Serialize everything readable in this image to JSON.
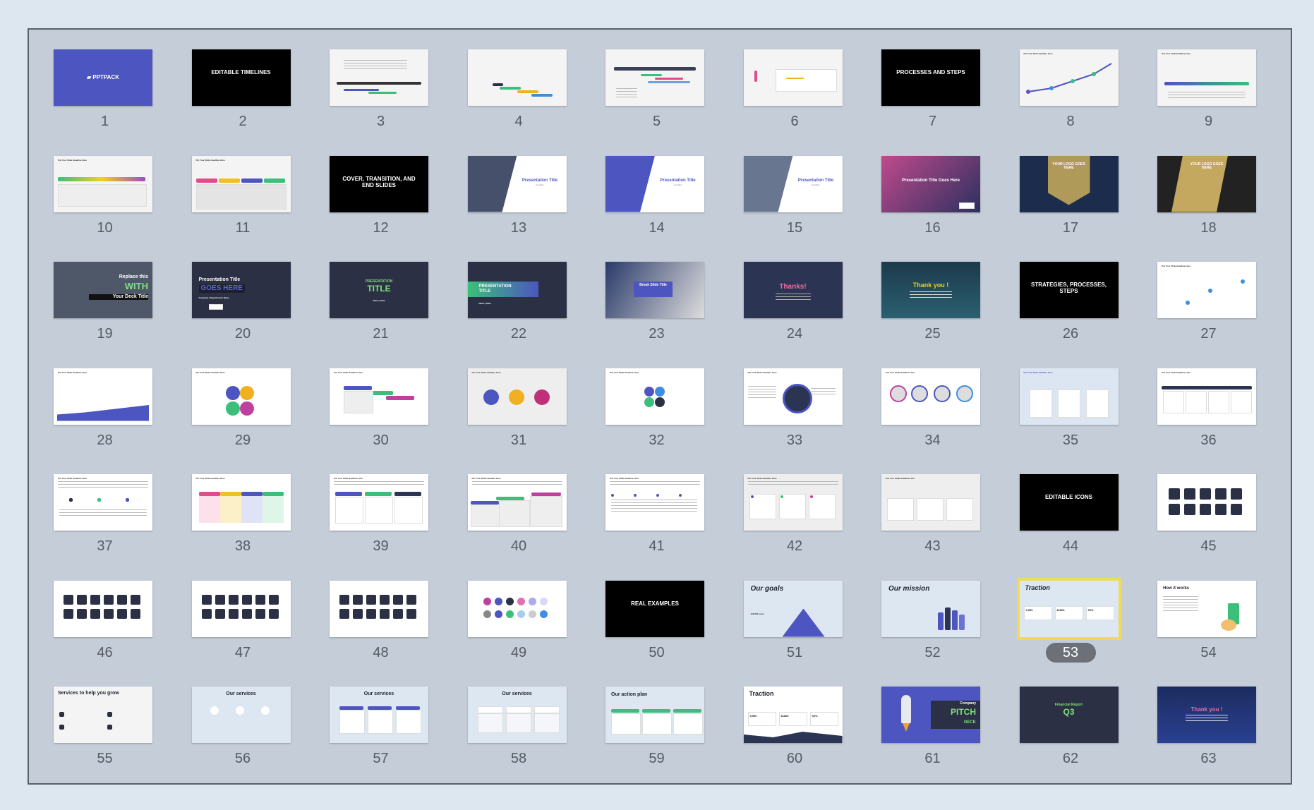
{
  "slides": [
    {
      "number": "1",
      "text": "▰ PPTPACK"
    },
    {
      "number": "2",
      "text": "EDITABLE TIMELINES"
    },
    {
      "number": "3",
      "text": ""
    },
    {
      "number": "4",
      "text": ""
    },
    {
      "number": "5",
      "text": ""
    },
    {
      "number": "6",
      "text": ""
    },
    {
      "number": "7",
      "text": "PROCESSES AND STEPS"
    },
    {
      "number": "8",
      "text": "Put Your Slide Headline Here"
    },
    {
      "number": "9",
      "text": "Put Your Slide Headline Here"
    },
    {
      "number": "10",
      "text": "Put Your Slide Headline Here"
    },
    {
      "number": "11",
      "text": "Put Your Slide Headline Here"
    },
    {
      "number": "12",
      "text": "COVER, TRANSITION, AND END SLIDES"
    },
    {
      "number": "13",
      "text": "Presentation Title",
      "sub": "Headline"
    },
    {
      "number": "14",
      "text": "Presentation Title",
      "sub": "Headline"
    },
    {
      "number": "15",
      "text": "Presentation Title",
      "sub": "Headline"
    },
    {
      "number": "16",
      "text": "Presentation Title Goes Here"
    },
    {
      "number": "17",
      "text": "YOUR LOGO GOES HERE"
    },
    {
      "number": "18",
      "text": "YOUR LOGO GOES HERE"
    },
    {
      "number": "19",
      "text": "Replace this",
      "sub": "WITH",
      "sub2": "Your Deck Title"
    },
    {
      "number": "20",
      "text": "Presentation Title",
      "sub": "GOES HERE",
      "sub2": "Company | Department | Name"
    },
    {
      "number": "21",
      "text": "PRESENTATION",
      "sub": "TITLE",
      "sub2": "Name | Date"
    },
    {
      "number": "22",
      "text": "PRESENTATION TITLE",
      "sub2": "Name | Date"
    },
    {
      "number": "23",
      "text": "Break Slide Title"
    },
    {
      "number": "24",
      "text": "Thanks!"
    },
    {
      "number": "25",
      "text": "Thank you !"
    },
    {
      "number": "26",
      "text": "STRATEGIES, PROCESSES, STEPS"
    },
    {
      "number": "27",
      "text": "Put Your Slide Headline Here"
    },
    {
      "number": "28",
      "text": "Put Your Slide Headline Here"
    },
    {
      "number": "29",
      "text": "Put Your Slide Headline Here"
    },
    {
      "number": "30",
      "text": "Put Your Slide Headline Here"
    },
    {
      "number": "31",
      "text": "Put Your Slide Headline Here"
    },
    {
      "number": "32",
      "text": "Put Your Slide Headline Here"
    },
    {
      "number": "33",
      "text": "Put Your Slide Headline Here"
    },
    {
      "number": "34",
      "text": "Put Your Slide Headline Here"
    },
    {
      "number": "35",
      "text": "Put Your Slide Headline Here"
    },
    {
      "number": "36",
      "text": "Put Your Slide Headline Here"
    },
    {
      "number": "37",
      "text": "Put Your Slide Headline Here"
    },
    {
      "number": "38",
      "text": "Put Your Slide Headline Here"
    },
    {
      "number": "39",
      "text": "Put Your Slide Headline Here"
    },
    {
      "number": "40",
      "text": "Put Your Slide Headline Here"
    },
    {
      "number": "41",
      "text": "Put Your Slide Headline Here"
    },
    {
      "number": "42",
      "text": "Put Your Slide Headline Here"
    },
    {
      "number": "43",
      "text": "Put Your Slide Headline Here"
    },
    {
      "number": "44",
      "text": "EDITABLE ICONS"
    },
    {
      "number": "45",
      "text": ""
    },
    {
      "number": "46",
      "text": ""
    },
    {
      "number": "47",
      "text": ""
    },
    {
      "number": "48",
      "text": ""
    },
    {
      "number": "49",
      "text": ""
    },
    {
      "number": "50",
      "text": "REAL EXAMPLES"
    },
    {
      "number": "51",
      "text": "Our goals",
      "sub": "100,000 users"
    },
    {
      "number": "52",
      "text": "Our mission"
    },
    {
      "number": "53",
      "text": "Traction",
      "sub": "3,500",
      "sub2": "$180k",
      "sub3": "53%"
    },
    {
      "number": "54",
      "text": "How it works"
    },
    {
      "number": "55",
      "text": "Services to help you grow"
    },
    {
      "number": "56",
      "text": "Our services"
    },
    {
      "number": "57",
      "text": "Our services"
    },
    {
      "number": "58",
      "text": "Our services"
    },
    {
      "number": "59",
      "text": "Our action plan"
    },
    {
      "number": "60",
      "text": "Traction",
      "sub": "3,500",
      "sub2": "$180k",
      "sub3": "53%"
    },
    {
      "number": "61",
      "text": "Company",
      "sub": "PITCH",
      "sub2": "DECK"
    },
    {
      "number": "62",
      "text": "Financial Report",
      "sub": "Q3"
    },
    {
      "number": "63",
      "text": "Thank you !"
    }
  ],
  "selected_slide": "53",
  "colors": {
    "background": "#dde7f0",
    "panel": "#c5cdd8",
    "selection": "#f0db58",
    "brand": "#4c55c0",
    "navy": "#2c3044"
  }
}
